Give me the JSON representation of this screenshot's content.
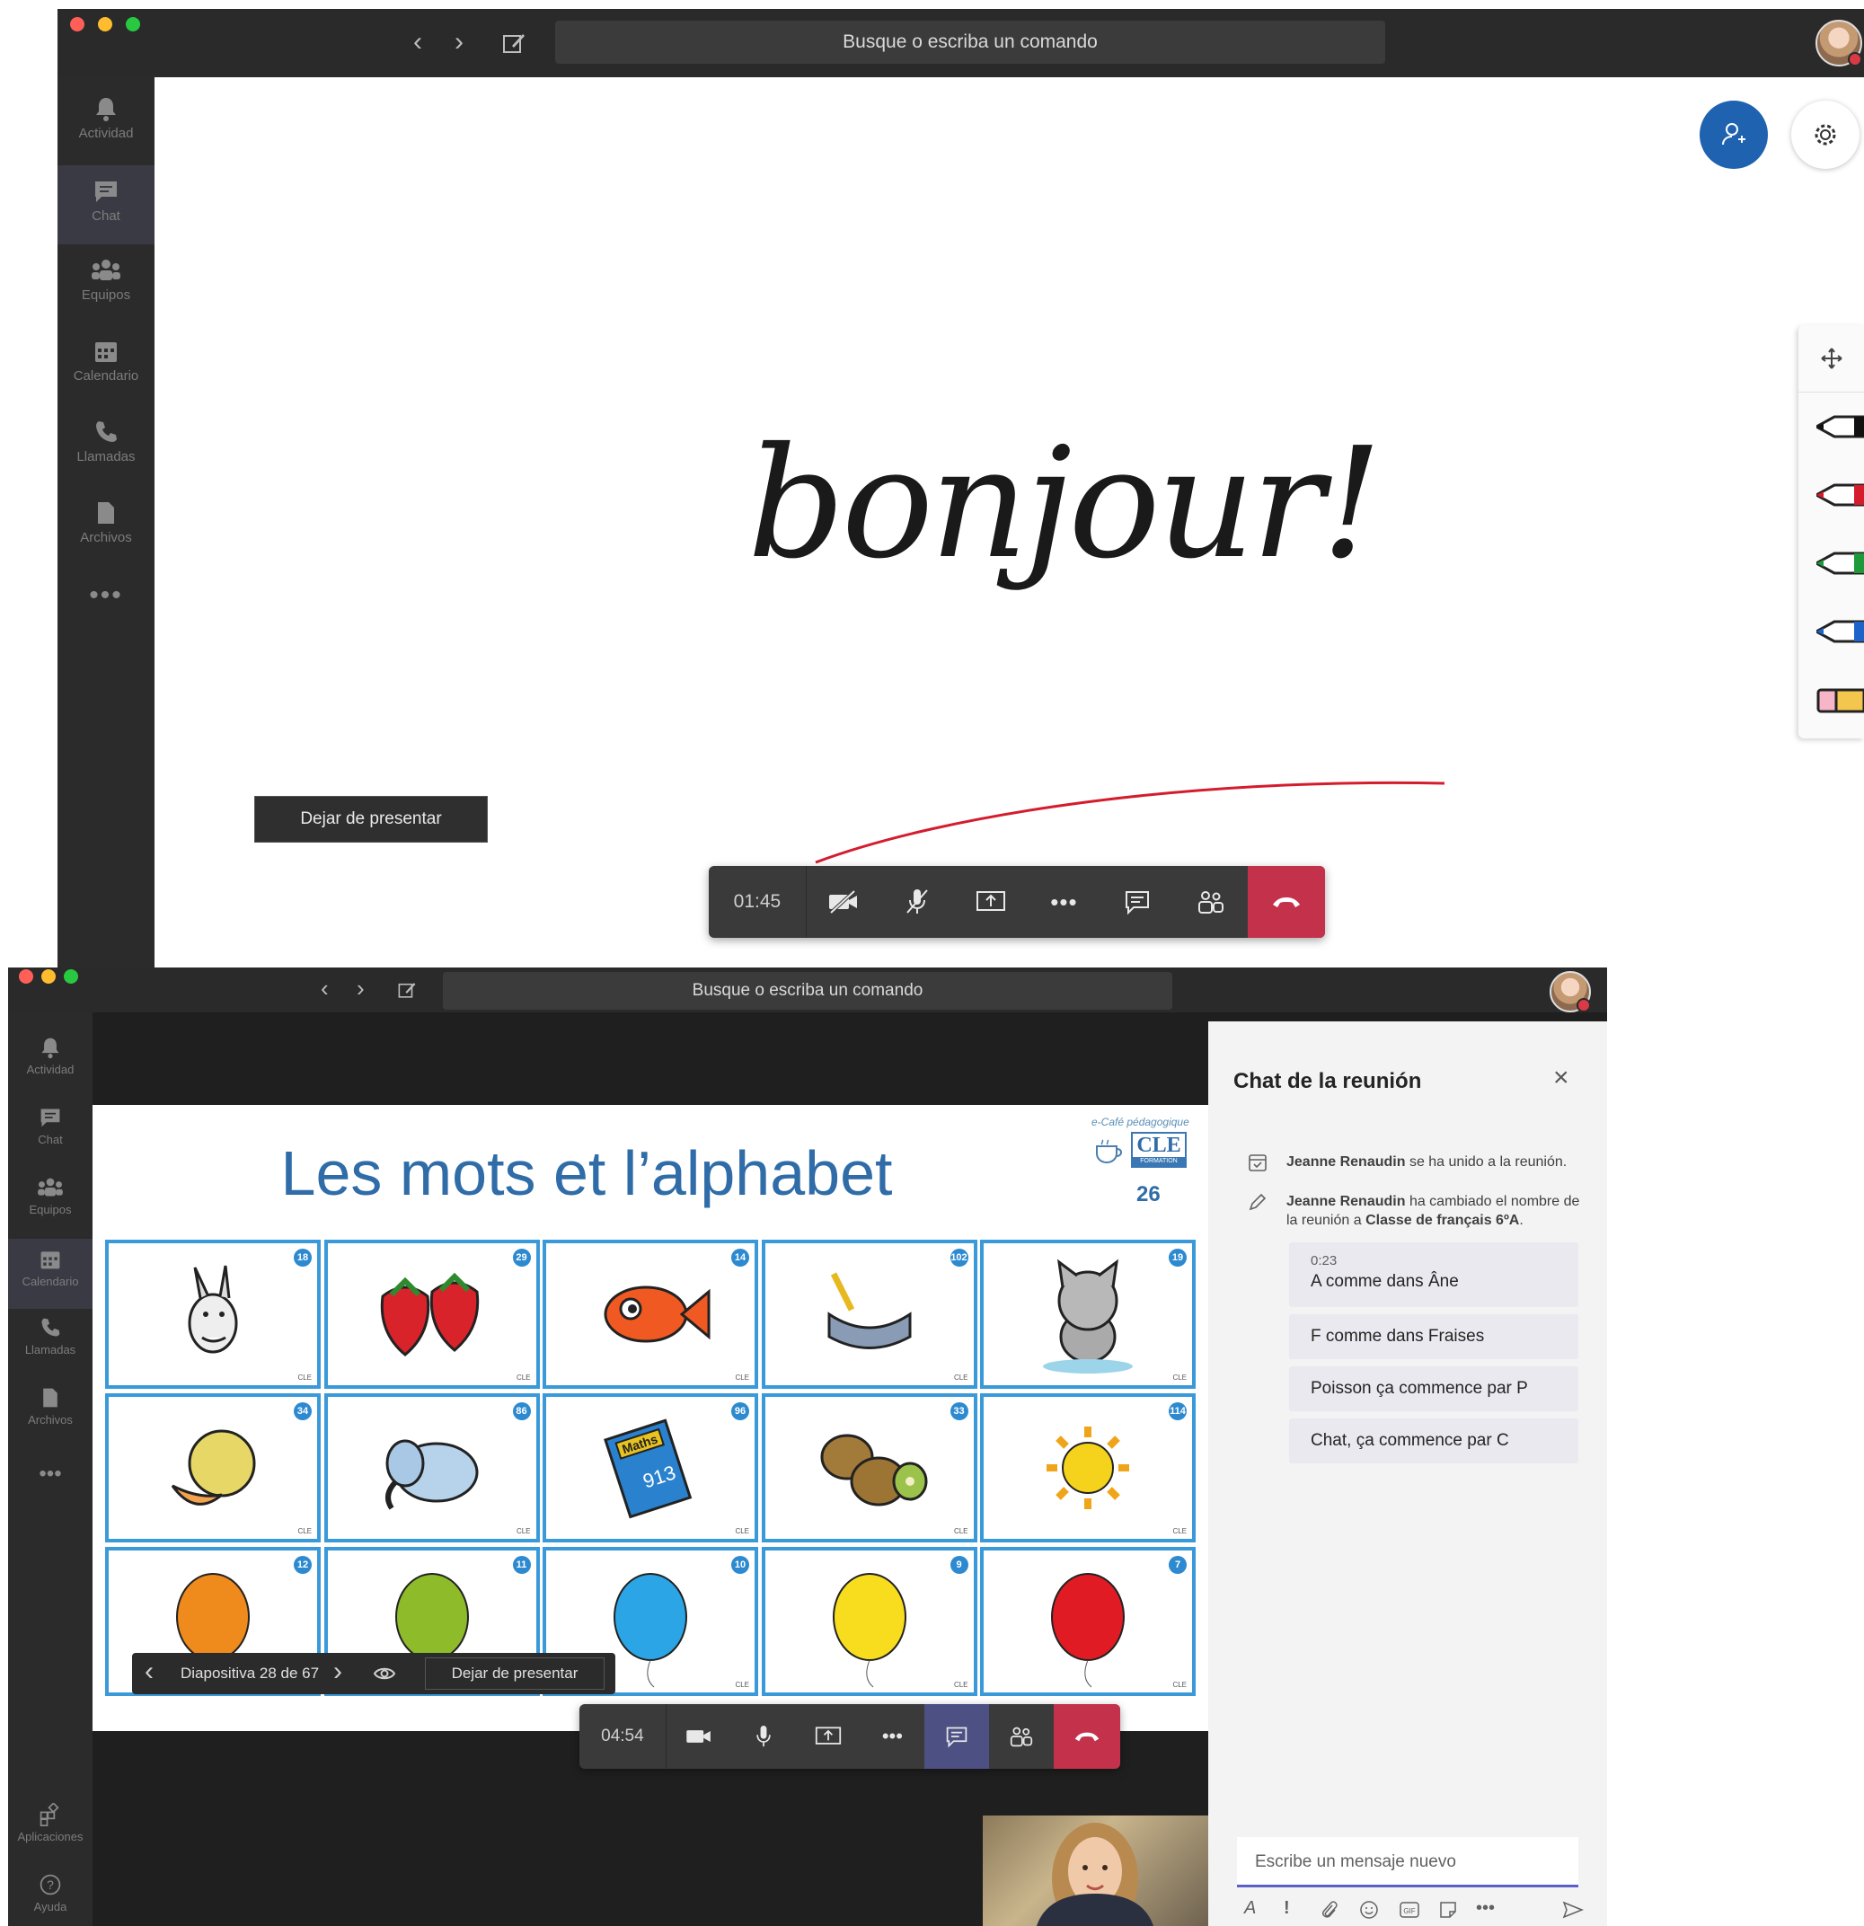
{
  "top_window": {
    "search_placeholder": "Busque o escriba un comando",
    "rail": [
      {
        "label": "Actividad",
        "icon": "bell-icon"
      },
      {
        "label": "Chat",
        "icon": "chat-icon"
      },
      {
        "label": "Equipos",
        "icon": "teams-icon"
      },
      {
        "label": "Calendario",
        "icon": "calendar-icon"
      },
      {
        "label": "Llamadas",
        "icon": "phone-icon"
      },
      {
        "label": "Archivos",
        "icon": "files-icon"
      }
    ],
    "whiteboard_text": "bonjour!",
    "stop_presenting_label": "Dejar de presentar",
    "call_timer": "01:45"
  },
  "bottom_window": {
    "search_placeholder": "Busque o escriba un comando",
    "rail": [
      {
        "label": "Actividad",
        "icon": "bell-icon"
      },
      {
        "label": "Chat",
        "icon": "chat-icon"
      },
      {
        "label": "Equipos",
        "icon": "teams-icon"
      },
      {
        "label": "Calendario",
        "icon": "calendar-icon"
      },
      {
        "label": "Llamadas",
        "icon": "phone-icon"
      },
      {
        "label": "Archivos",
        "icon": "files-icon"
      }
    ],
    "rail_bottom": [
      {
        "label": "Aplicaciones",
        "icon": "apps-icon"
      },
      {
        "label": "Ayuda",
        "icon": "help-icon"
      }
    ],
    "slide": {
      "title": "Les mots et l’alphabet",
      "logo_tagline": "e-Café pédagogique",
      "logo_text": "CLE",
      "logo_sub": "FORMATION",
      "page_number": "26",
      "cells": [
        {
          "badge": "18",
          "item": "donkey"
        },
        {
          "badge": "29",
          "item": "strawberries"
        },
        {
          "badge": "14",
          "item": "fish"
        },
        {
          "badge": "102",
          "item": "pencil-case"
        },
        {
          "badge": "19",
          "item": "cat"
        },
        {
          "badge": "34",
          "item": "melon"
        },
        {
          "badge": "86",
          "item": "elephant"
        },
        {
          "badge": "96",
          "item": "maths-book"
        },
        {
          "badge": "33",
          "item": "kiwis"
        },
        {
          "badge": "114",
          "item": "sun"
        },
        {
          "badge": "12",
          "item": "orange-balloon"
        },
        {
          "badge": "11",
          "item": "green-balloon"
        },
        {
          "badge": "10",
          "item": "blue-balloon"
        },
        {
          "badge": "9",
          "item": "yellow-balloon"
        },
        {
          "badge": "7",
          "item": "red-balloon"
        }
      ],
      "book_text": "Maths",
      "cell_mark": "CLE"
    },
    "slide_nav": {
      "label": "Diapositiva 28 de 67",
      "stop_presenting_label": "Dejar de presentar"
    },
    "call_timer": "04:54",
    "chat": {
      "title": "Chat de la reunión",
      "events": [
        {
          "name": "Jeanne Renaudin",
          "text": "se ha unido a la reunión."
        },
        {
          "name": "Jeanne Renaudin",
          "text": "ha cambiado el nombre de la reunión a",
          "bold_end": "Classe de français 6ºA",
          "end": "."
        }
      ],
      "messages": [
        {
          "time": "0:23",
          "text": "A comme dans Âne"
        },
        {
          "text": "F comme dans Fraises"
        },
        {
          "text": "Poisson ça commence par P"
        },
        {
          "text": "Chat, ça commence par C"
        }
      ],
      "input_placeholder": "Escribe un mensaje nuevo"
    }
  }
}
